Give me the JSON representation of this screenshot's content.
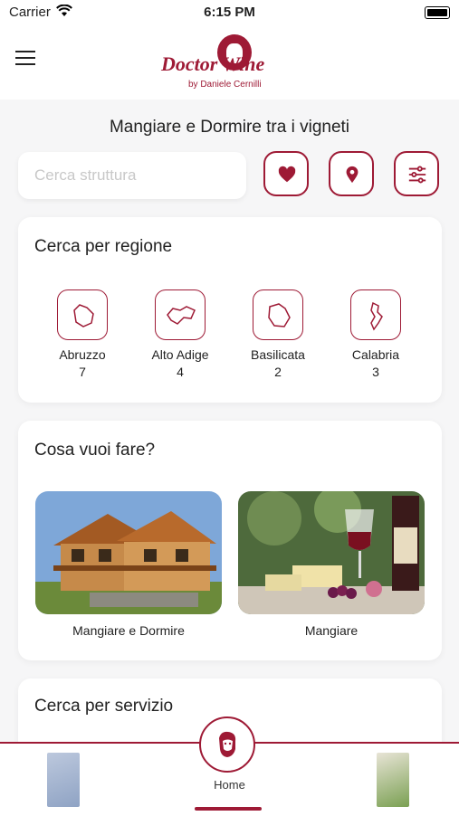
{
  "status": {
    "carrier": "Carrier",
    "time": "6:15 PM"
  },
  "header": {
    "menu_icon": "hamburger-icon",
    "logo_name": "Doctor Wine",
    "logo_byline": "by Daniele Cernilli"
  },
  "subtitle": "Mangiare e Dormire tra i vigneti",
  "search": {
    "placeholder": "Cerca struttura",
    "favorites_icon": "heart-icon",
    "map_icon": "location-pin-icon",
    "filters_icon": "sliders-icon"
  },
  "regions": {
    "title": "Cerca per regione",
    "items": [
      {
        "name": "Abruzzo",
        "count": "7",
        "icon": "abruzzo-map-icon"
      },
      {
        "name": "Alto Adige",
        "count": "4",
        "icon": "alto-adige-map-icon"
      },
      {
        "name": "Basilicata",
        "count": "2",
        "icon": "basilicata-map-icon"
      },
      {
        "name": "Calabria",
        "count": "3",
        "icon": "calabria-map-icon"
      }
    ]
  },
  "activities": {
    "title": "Cosa vuoi fare?",
    "items": [
      {
        "label": "Mangiare e Dormire",
        "image": "wooden-lodge-photo"
      },
      {
        "label": "Mangiare",
        "image": "wine-cheese-photo"
      }
    ]
  },
  "services": {
    "title": "Cerca per servizio"
  },
  "tabbar": {
    "home_label": "Home",
    "home_icon": "doctor-wine-face-icon",
    "left_icon": "guide-book-icon",
    "right_icon": "guide-book-icon"
  },
  "colors": {
    "accent": "#9e1a35",
    "background": "#f6f6f7"
  }
}
